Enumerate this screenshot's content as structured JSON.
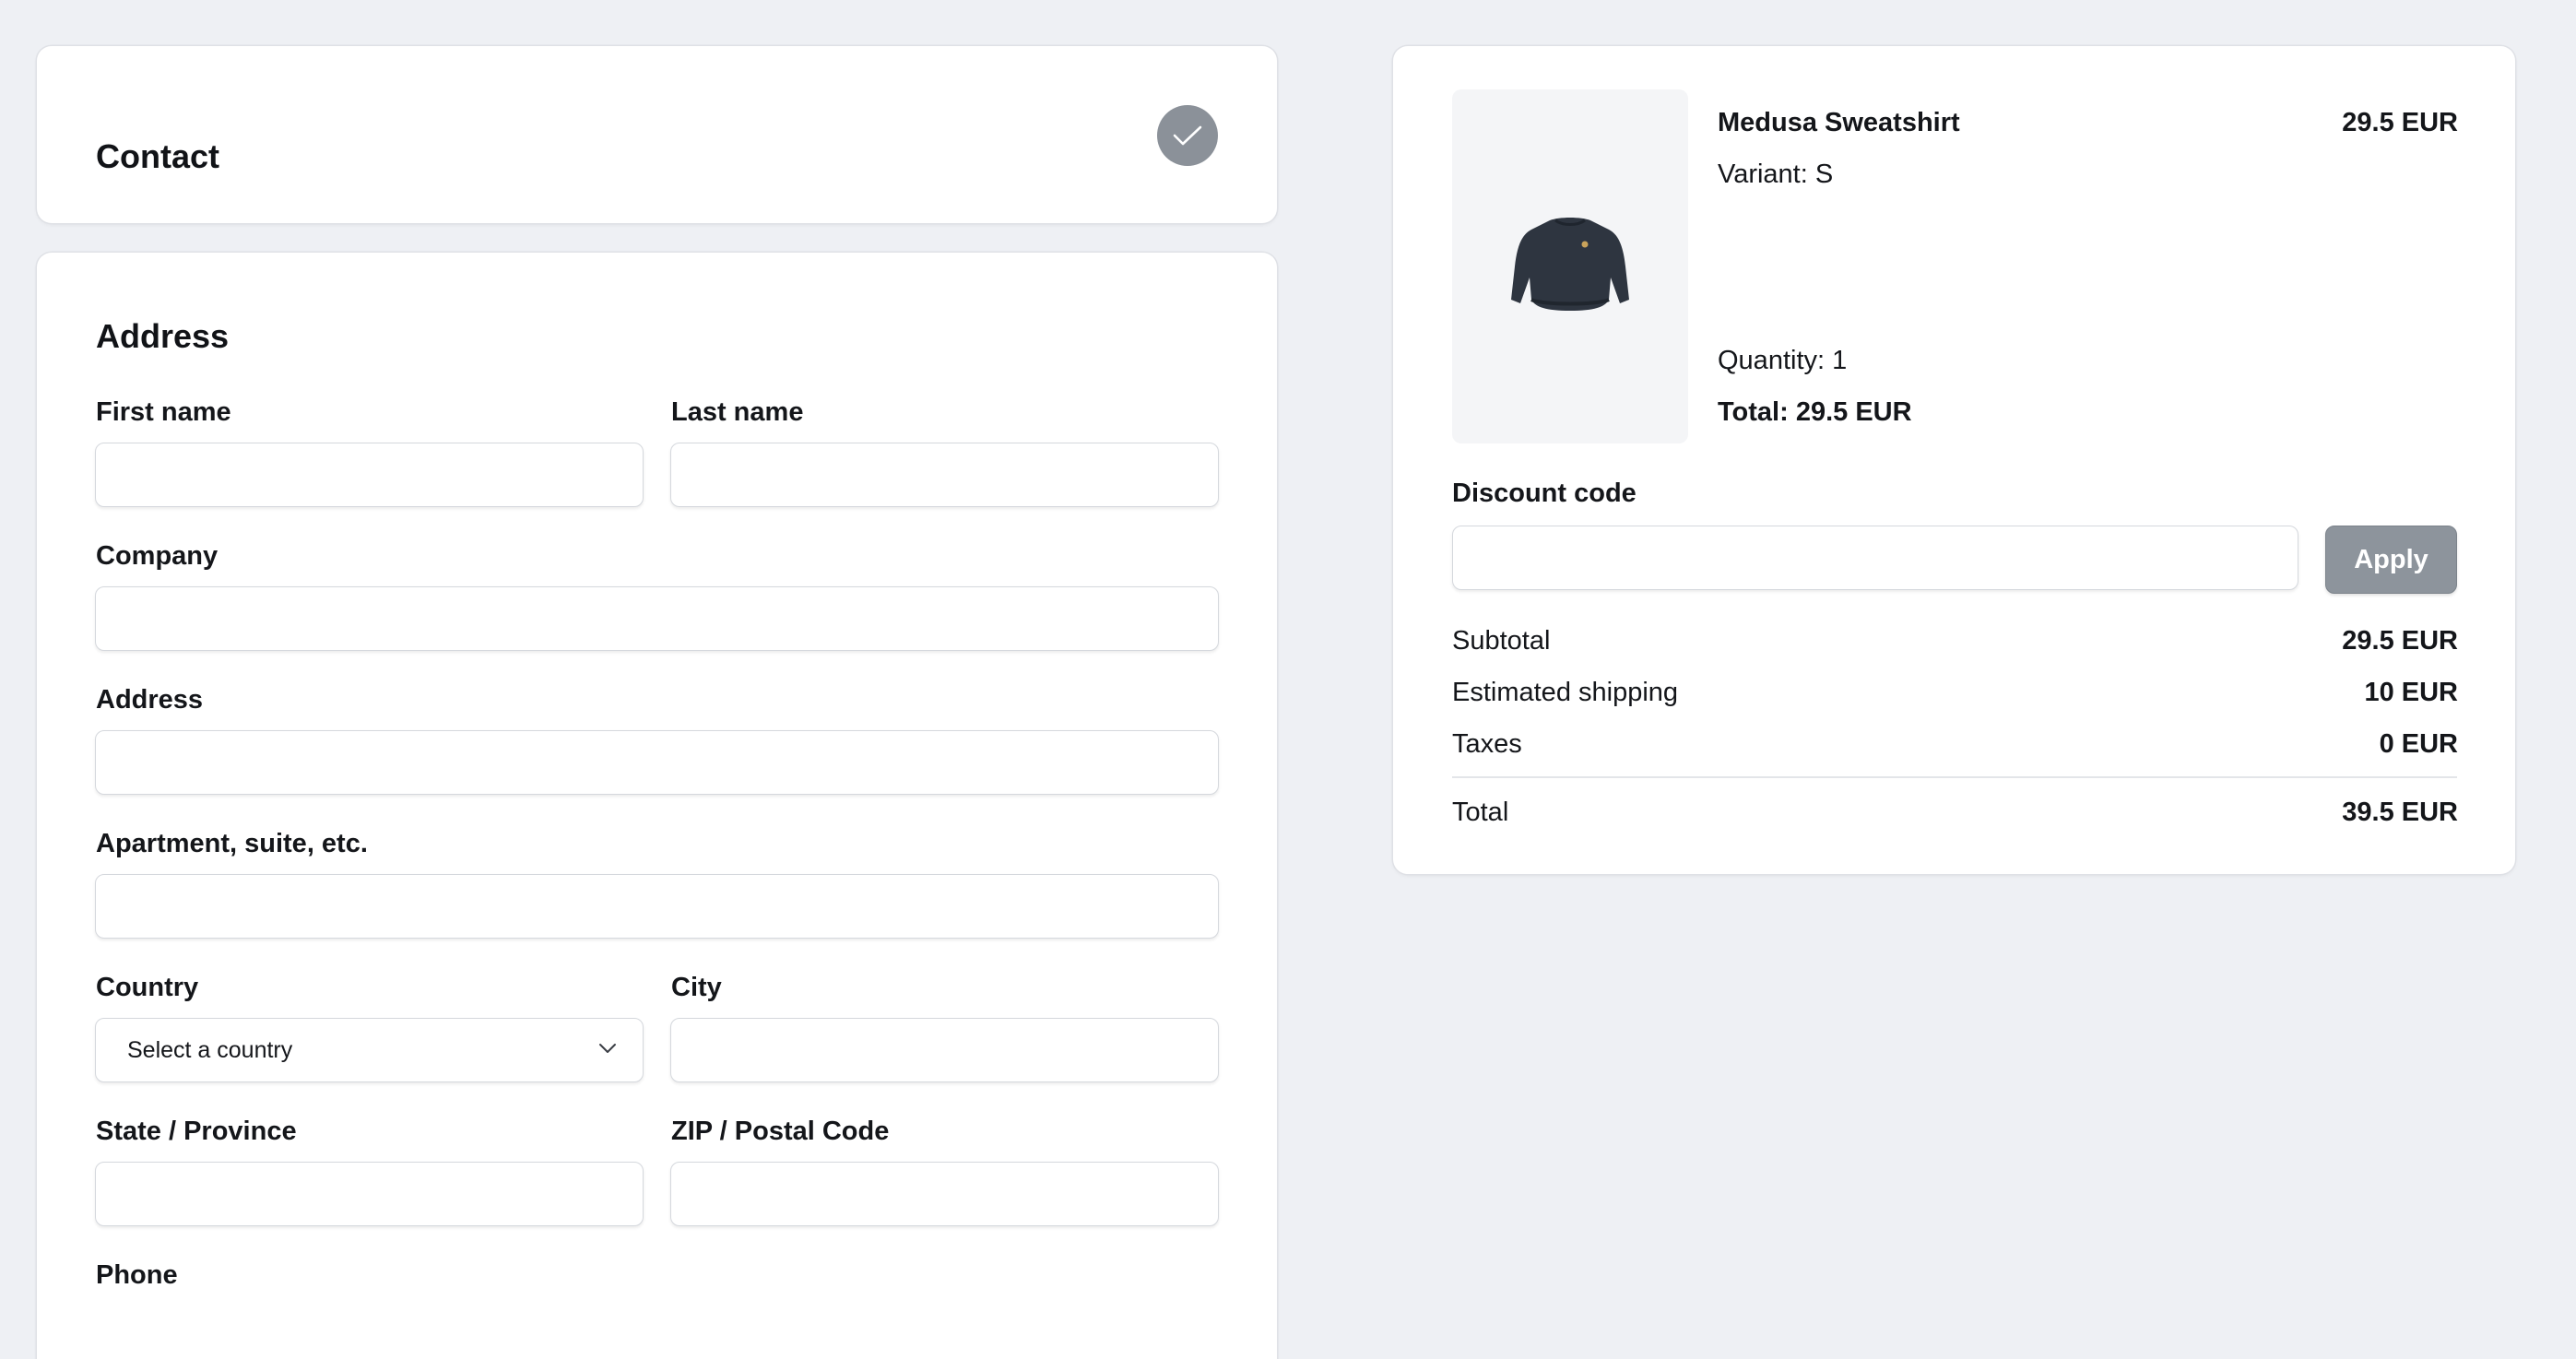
{
  "contact": {
    "title": "Contact"
  },
  "address": {
    "title": "Address",
    "fields": {
      "first_name": {
        "label": "First name",
        "value": ""
      },
      "last_name": {
        "label": "Last name",
        "value": ""
      },
      "company": {
        "label": "Company",
        "value": ""
      },
      "address": {
        "label": "Address",
        "value": ""
      },
      "apartment": {
        "label": "Apartment, suite, etc.",
        "value": ""
      },
      "country": {
        "label": "Country",
        "selected": "Select a country"
      },
      "city": {
        "label": "City",
        "value": ""
      },
      "state": {
        "label": "State / Province",
        "value": ""
      },
      "zip": {
        "label": "ZIP / Postal Code",
        "value": ""
      },
      "phone": {
        "label": "Phone"
      }
    }
  },
  "summary": {
    "item": {
      "name": "Medusa Sweatshirt",
      "price": "29.5 EUR",
      "variant": "Variant: S",
      "quantity": "Quantity: 1",
      "total": "Total: 29.5 EUR"
    },
    "discount": {
      "label": "Discount code",
      "value": "",
      "apply_label": "Apply"
    },
    "totals": {
      "subtotal_label": "Subtotal",
      "subtotal_value": "29.5 EUR",
      "shipping_label": "Estimated shipping",
      "shipping_value": "10 EUR",
      "taxes_label": "Taxes",
      "taxes_value": "0 EUR",
      "total_label": "Total",
      "total_value": "39.5 EUR"
    }
  },
  "colors": {
    "background": "#eef0f4",
    "check_badge": "#8b9199",
    "apply_button": "#8d949c"
  },
  "icons": {
    "contact_status": "check-icon",
    "country_select": "chevron-down-icon",
    "product_image": "sweatshirt-icon"
  }
}
